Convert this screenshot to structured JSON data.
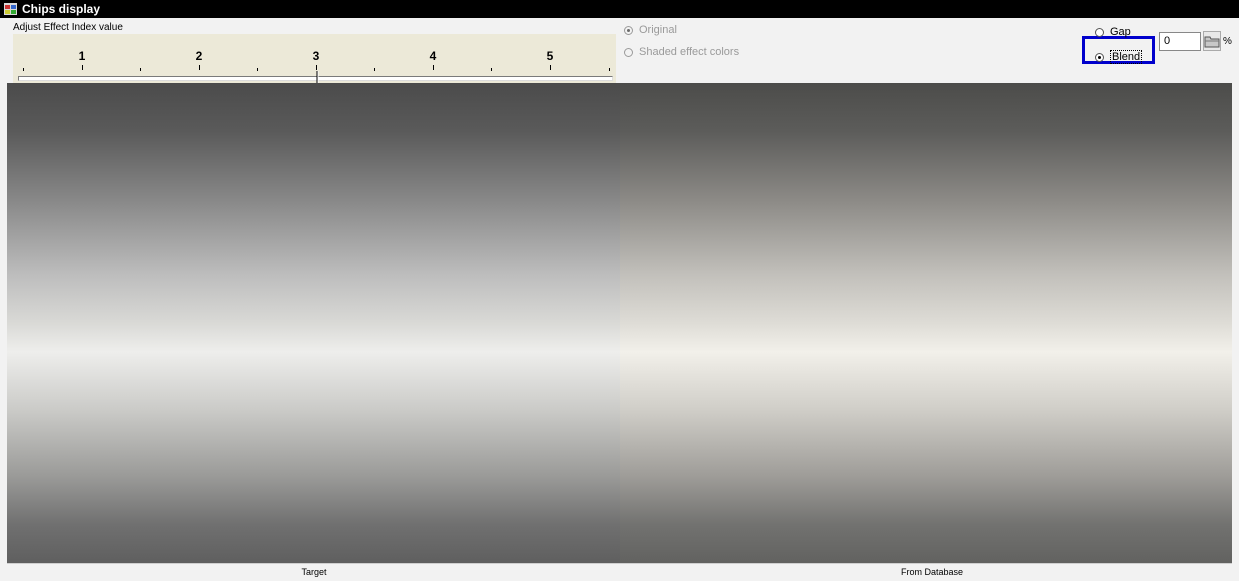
{
  "window": {
    "title": "Chips display"
  },
  "slider": {
    "label": "Adjust Effect Index value",
    "tick_labels": [
      "1",
      "2",
      "3",
      "4",
      "5"
    ],
    "value": 3
  },
  "display_mode": {
    "options": [
      {
        "label": "Original",
        "selected": true,
        "enabled": false
      },
      {
        "label": "Shaded effect colors",
        "selected": false,
        "enabled": false
      }
    ]
  },
  "separator": {
    "gap_label": "Gap",
    "blend_label": "Blend",
    "selected": "Blend",
    "percent_value": "0",
    "percent_suffix": "%"
  },
  "chips": {
    "left_label": "Target",
    "right_label": "From Database"
  }
}
